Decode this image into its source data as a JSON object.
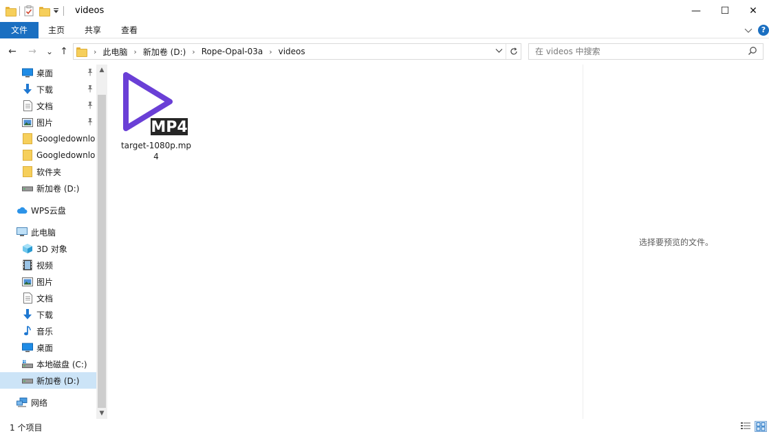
{
  "window": {
    "title": "videos",
    "controls": {
      "minimize": "—",
      "maximize": "☐",
      "close": "✕"
    }
  },
  "ribbon": {
    "tabs": [
      "文件",
      "主页",
      "共享",
      "查看"
    ]
  },
  "navigation": {
    "back": "←",
    "forward": "→",
    "recent": "⌄",
    "up": "↑"
  },
  "address": {
    "crumbs": [
      "此电脑",
      "新加卷 (D:)",
      "Rope-Opal-03a",
      "videos"
    ]
  },
  "search": {
    "placeholder": "在 videos 中搜索"
  },
  "sidebar": {
    "quick_access": [
      {
        "label": "桌面",
        "icon": "desktop-icon",
        "pinned": true
      },
      {
        "label": "下载",
        "icon": "download-icon",
        "pinned": true
      },
      {
        "label": "文档",
        "icon": "document-icon",
        "pinned": true
      },
      {
        "label": "图片",
        "icon": "picture-icon",
        "pinned": true
      },
      {
        "label": "Googledownlo",
        "icon": "folder-icon",
        "pinned": false
      },
      {
        "label": "Googledownlo",
        "icon": "folder-icon",
        "pinned": false
      },
      {
        "label": "软件夹",
        "icon": "folder-icon",
        "pinned": false
      },
      {
        "label": "新加卷 (D:)",
        "icon": "drive-icon",
        "pinned": false
      }
    ],
    "wps": "WPS云盘",
    "this_pc": "此电脑",
    "this_pc_items": [
      {
        "label": "3D 对象",
        "icon": "3d-objects-icon"
      },
      {
        "label": "视频",
        "icon": "video-icon"
      },
      {
        "label": "图片",
        "icon": "picture-icon"
      },
      {
        "label": "文档",
        "icon": "document-icon"
      },
      {
        "label": "下载",
        "icon": "download-icon"
      },
      {
        "label": "音乐",
        "icon": "music-icon"
      },
      {
        "label": "桌面",
        "icon": "desktop-icon"
      },
      {
        "label": "本地磁盘 (C:)",
        "icon": "system-drive-icon"
      },
      {
        "label": "新加卷 (D:)",
        "icon": "drive-icon",
        "selected": true
      }
    ],
    "network": "网络"
  },
  "files": [
    {
      "name": "target-1080p.mp4",
      "icon": "mp4-file-icon",
      "badge": "MP4"
    }
  ],
  "preview": {
    "message": "选择要预览的文件。"
  },
  "status": {
    "count": "1 个项目"
  },
  "colors": {
    "accent": "#1a6fc1",
    "selection": "#cce4f7",
    "mp4_purple": "#6a3fd6"
  }
}
